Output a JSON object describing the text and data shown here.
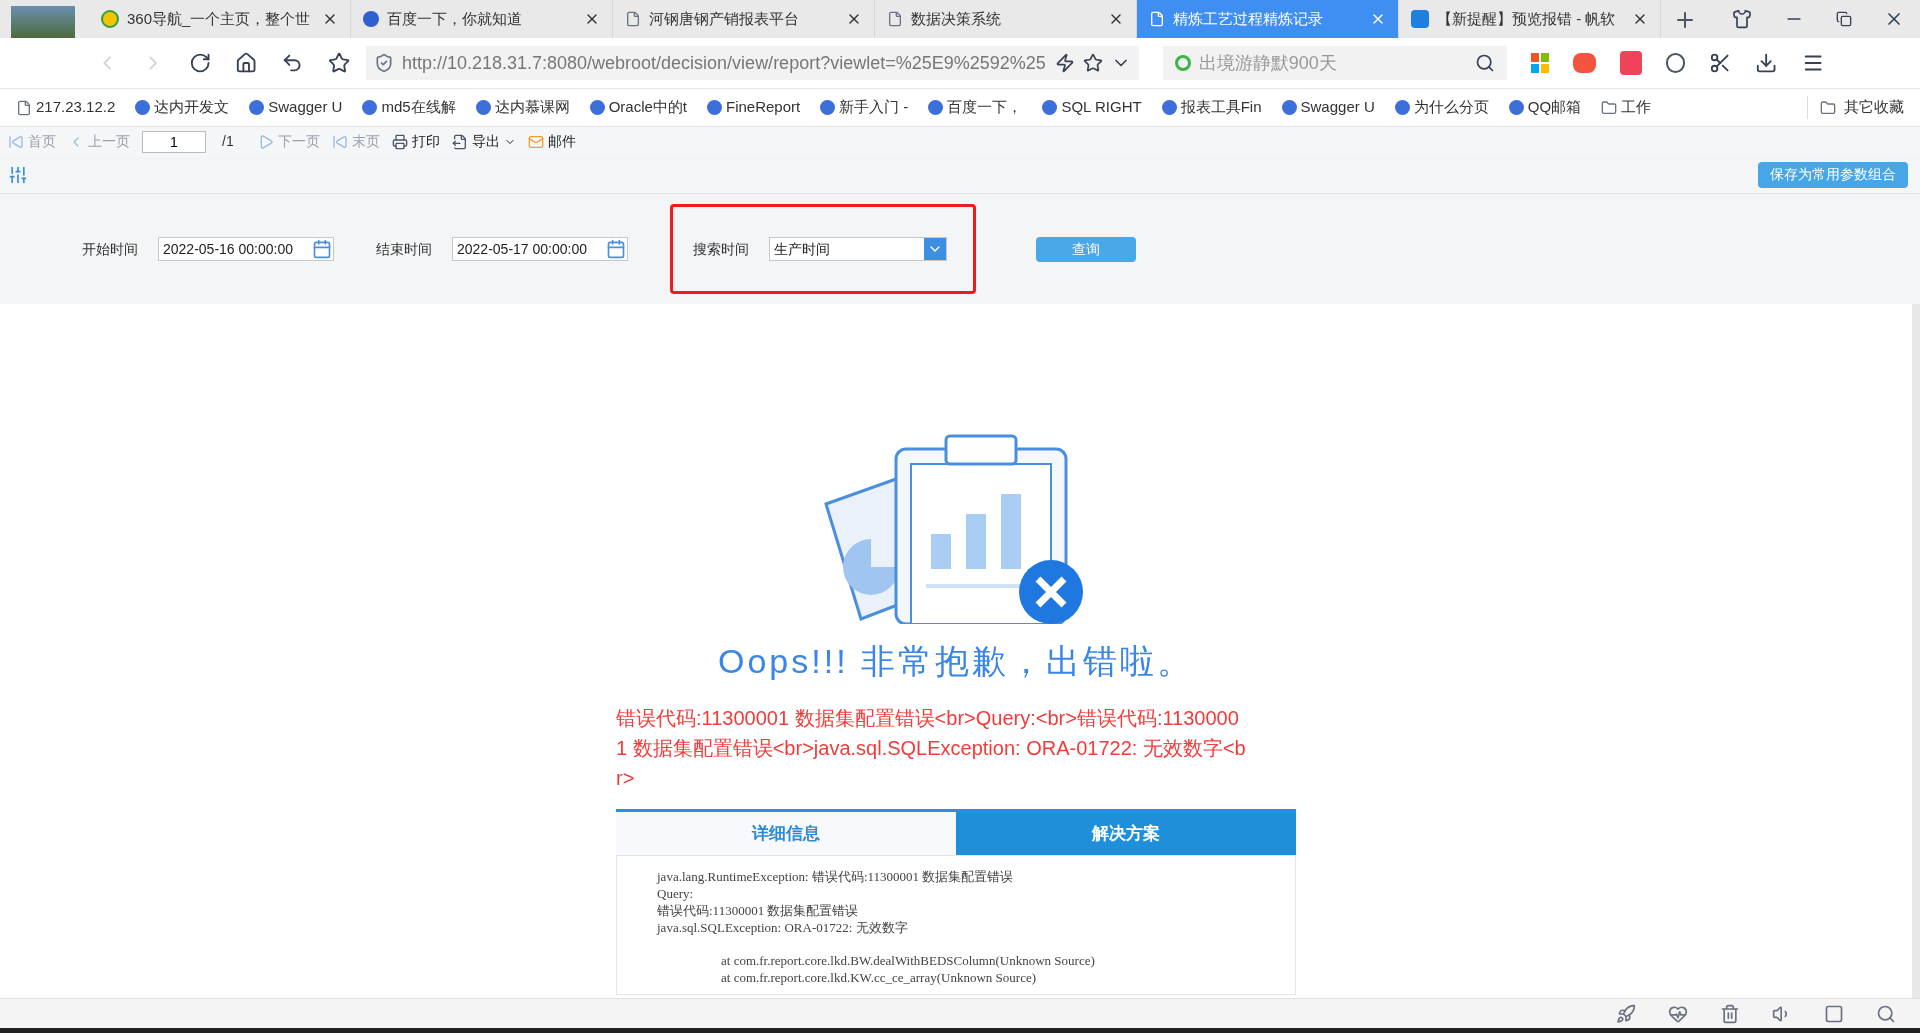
{
  "browser": {
    "tabs": [
      {
        "title": "360导航_一个主页，整个世",
        "selected": false
      },
      {
        "title": "百度一下，你就知道",
        "selected": false
      },
      {
        "title": "河钢唐钢产销报表平台",
        "selected": false
      },
      {
        "title": "数据决策系统",
        "selected": false
      },
      {
        "title": "精炼工艺过程精炼记录",
        "selected": true
      },
      {
        "title": "【新提醒】预览报错 - 帆软",
        "selected": false
      }
    ],
    "address": "http://10.218.31.7:8080/webroot/decision/view/report?viewlet=%25E9%2592%25",
    "search": {
      "placeholder": "出境游静默900天"
    },
    "bookmarks": [
      "217.23.12.2",
      "达内开发文",
      "Swagger U",
      "md5在线解",
      "达内慕课网",
      "Oracle中的t",
      "FineReport",
      "新手入门 -",
      "百度一下，",
      "SQL RIGHT",
      "报表工具Fin",
      "Swagger U",
      "为什么分页",
      "QQ邮箱",
      "工作"
    ],
    "other_bookmarks": "其它收藏"
  },
  "report_toolbar": {
    "items": [
      {
        "kind": "first",
        "label": "首页",
        "disabled": true
      },
      {
        "kind": "prev",
        "label": "上一页",
        "disabled": true
      },
      {
        "kind": "page",
        "value": "1",
        "total": "/1"
      },
      {
        "kind": "next",
        "label": "下一页",
        "disabled": true
      },
      {
        "kind": "last",
        "label": "末页",
        "disabled": true
      },
      {
        "kind": "print",
        "label": "打印",
        "disabled": false
      },
      {
        "kind": "export",
        "label": "导出",
        "disabled": false
      },
      {
        "kind": "mail",
        "label": "邮件",
        "disabled": false
      }
    ]
  },
  "params": {
    "save_button": "保存为常用参数组合",
    "start": {
      "label": "开始时间",
      "value": "2022-05-16 00:00:00"
    },
    "end": {
      "label": "结束时间",
      "value": "2022-05-17 00:00:00"
    },
    "search_time": {
      "label": "搜索时间",
      "value": "生产时间"
    },
    "query_button": "查询"
  },
  "error": {
    "title": "Oops!!! 非常抱歉，出错啦。",
    "message": "错误代码:11300001 数据集配置错误<br>Query:<br>错误代码:11300001 数据集配置错误<br>java.sql.SQLException: ORA-01722: 无效数字<br>",
    "tabs": [
      {
        "label": "详细信息",
        "selected": true
      },
      {
        "label": "解决方案",
        "selected": false
      }
    ],
    "detail_lines": [
      "java.lang.RuntimeException: 错误代码:11300001 数据集配置错误",
      "Query:",
      "错误代码:11300001 数据集配置错误",
      "java.sql.SQLException: ORA-01722: 无效数字",
      "at com.fr.report.core.lkd.BW.dealWithBEDSColumn(Unknown Source)",
      "at com.fr.report.core.lkd.KW.cc_ce_array(Unknown Source)"
    ]
  }
}
